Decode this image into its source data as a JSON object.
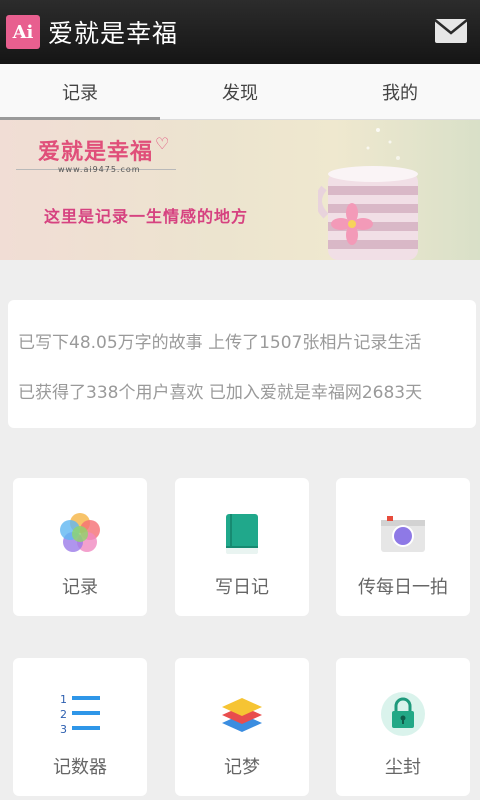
{
  "header": {
    "logo_text": "Ai",
    "title": "爱就是幸福"
  },
  "tabs": [
    {
      "label": "记录",
      "active": true
    },
    {
      "label": "发现"
    },
    {
      "label": "我的"
    }
  ],
  "banner": {
    "brand": "爱就是幸福",
    "url": "www.ai9475.com",
    "slogan": "这里是记录一生情感的地方"
  },
  "stats": {
    "line1": "已写下48.05万字的故事 上传了1507张相片记录生活",
    "line2": "已获得了338个用户喜欢 已加入爱就是幸福网2683天"
  },
  "grid": [
    {
      "label": "记录",
      "icon": "flower-icon"
    },
    {
      "label": "写日记",
      "icon": "diary-book-icon"
    },
    {
      "label": "传每日一拍",
      "icon": "camera-icon"
    },
    {
      "label": "记数器",
      "icon": "numbered-list-icon",
      "icon_numbers": [
        "1",
        "2",
        "3"
      ]
    },
    {
      "label": "记梦",
      "icon": "layers-icon"
    },
    {
      "label": "尘封",
      "icon": "lock-icon"
    }
  ]
}
